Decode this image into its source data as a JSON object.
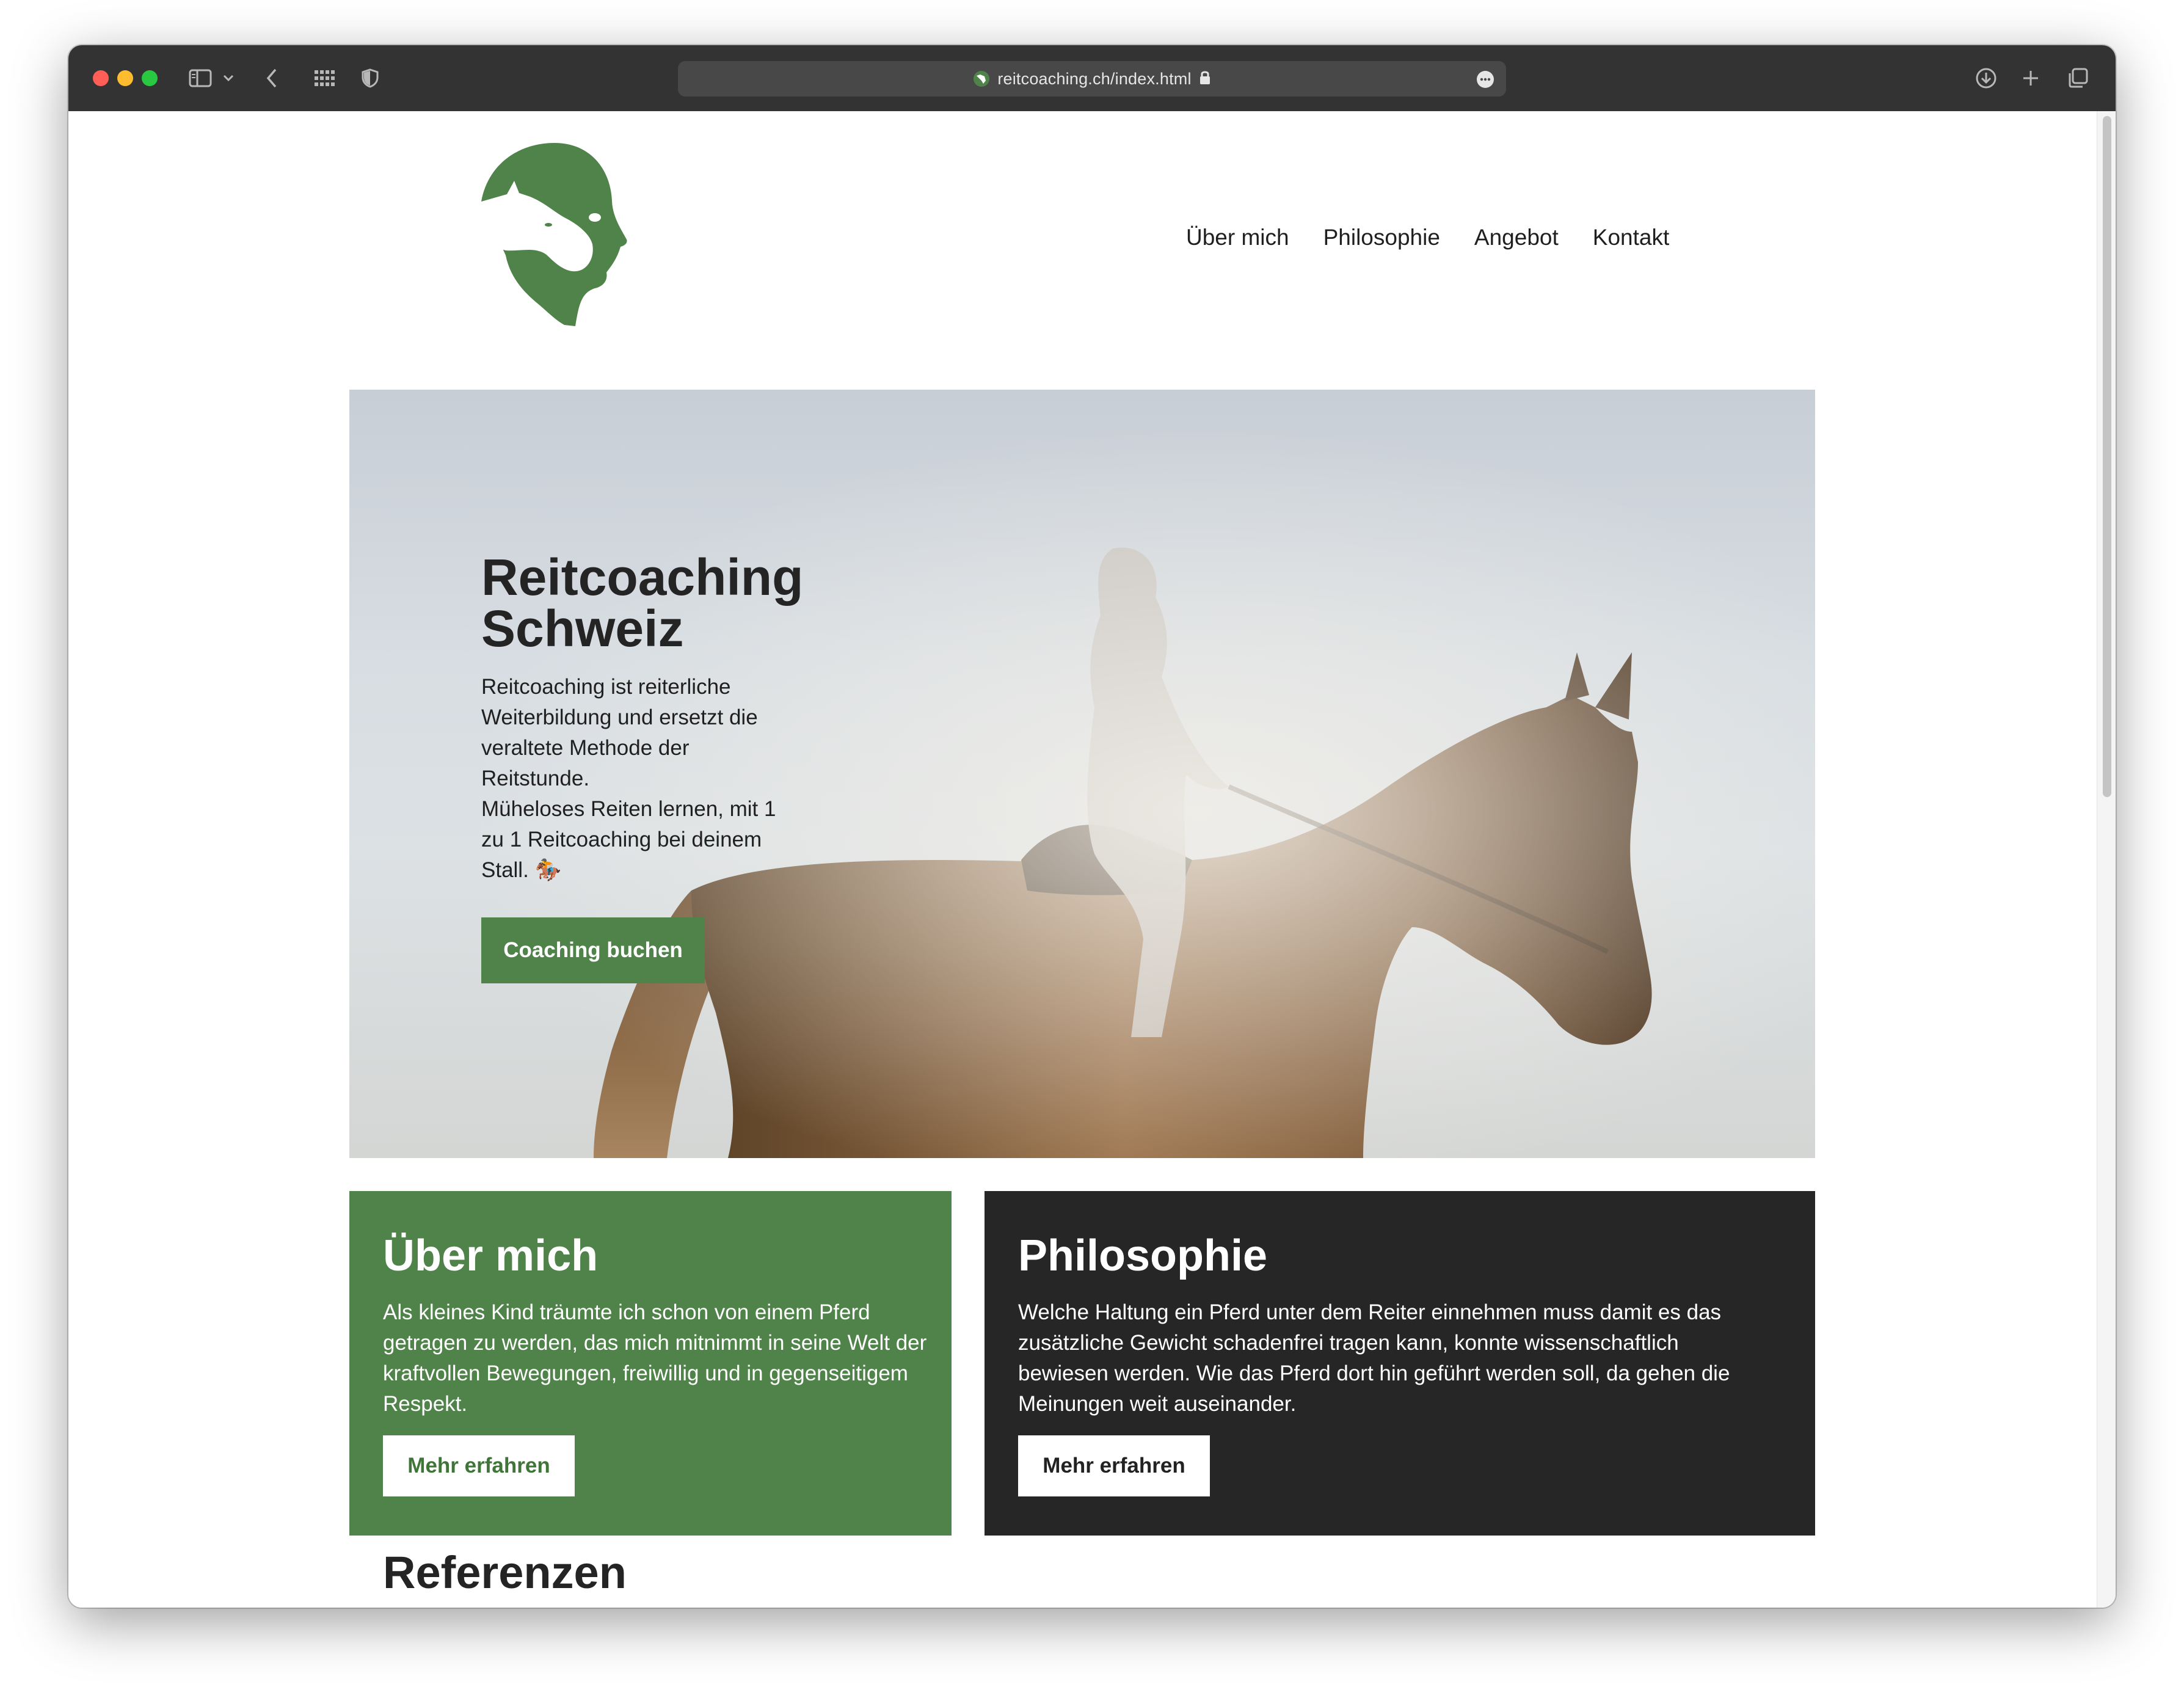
{
  "browser": {
    "url": "reitcoaching.ch/index.html",
    "icons": [
      "sidebar-icon",
      "chevron-down-icon",
      "back-icon",
      "tab-overview-icon",
      "shield-icon",
      "lock-icon",
      "more-icon",
      "download-icon",
      "plus-icon",
      "tabs-icon"
    ]
  },
  "header": {
    "logo_icon": "horse-head-logo",
    "nav": [
      {
        "label": "Über mich"
      },
      {
        "label": "Philosophie"
      },
      {
        "label": "Angebot"
      },
      {
        "label": "Kontakt"
      }
    ]
  },
  "hero": {
    "title": "Reitcoaching Schweiz",
    "paragraph_1": "Reitcoaching ist reiterliche Weiterbildung und ersetzt die veraltete Methode der Reitstunde.",
    "paragraph_2": "Müheloses Reiten lernen, mit 1 zu 1 Reitcoaching bei deinem Stall. 🏇",
    "button_label": "Coaching buchen",
    "image": "rider-on-horse-photo"
  },
  "cards": [
    {
      "title": "Über mich",
      "text": "Als kleines Kind träumte ich schon von einem Pferd getragen zu werden, das mich mitnimmt in seine Welt der kraftvollen Bewegungen, freiwillig und in gegenseitigem Respekt.",
      "button_label": "Mehr erfahren"
    },
    {
      "title": "Philosophie",
      "text": "Welche Haltung ein Pferd unter dem Reiter einnehmen muss damit es das zusätzliche Gewicht schadenfrei tragen kann, konnte wissenschaftlich bewiesen werden. Wie das Pferd dort hin geführt werden soll, da gehen die Meinungen weit auseinander.",
      "button_label": "Mehr erfahren"
    }
  ],
  "references": {
    "heading": "Referenzen"
  },
  "colors": {
    "brand_green": "#4f8349",
    "dark_card": "#262626",
    "toolbar": "#333333"
  }
}
